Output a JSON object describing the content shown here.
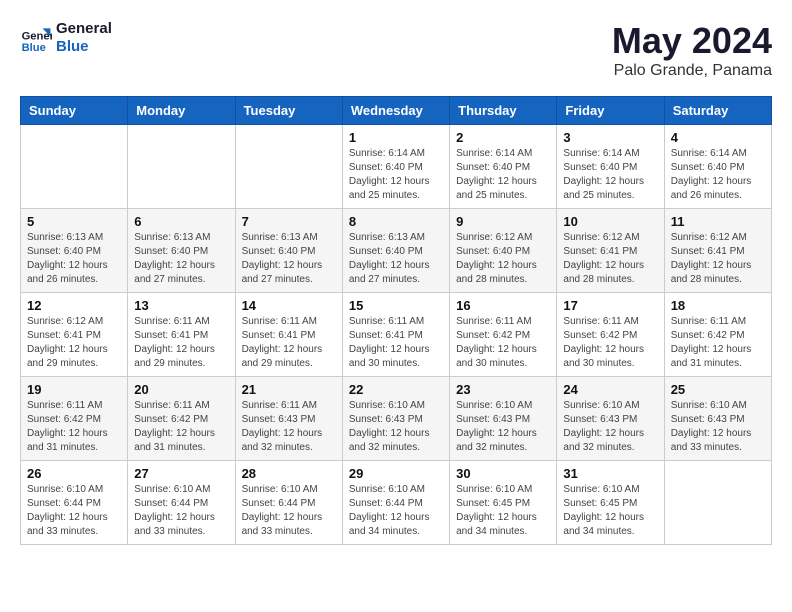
{
  "header": {
    "logo_line1": "General",
    "logo_line2": "Blue",
    "title": "May 2024",
    "subtitle": "Palo Grande, Panama"
  },
  "weekdays": [
    "Sunday",
    "Monday",
    "Tuesday",
    "Wednesday",
    "Thursday",
    "Friday",
    "Saturday"
  ],
  "weeks": [
    [
      {
        "day": "",
        "info": ""
      },
      {
        "day": "",
        "info": ""
      },
      {
        "day": "",
        "info": ""
      },
      {
        "day": "1",
        "info": "Sunrise: 6:14 AM\nSunset: 6:40 PM\nDaylight: 12 hours\nand 25 minutes."
      },
      {
        "day": "2",
        "info": "Sunrise: 6:14 AM\nSunset: 6:40 PM\nDaylight: 12 hours\nand 25 minutes."
      },
      {
        "day": "3",
        "info": "Sunrise: 6:14 AM\nSunset: 6:40 PM\nDaylight: 12 hours\nand 25 minutes."
      },
      {
        "day": "4",
        "info": "Sunrise: 6:14 AM\nSunset: 6:40 PM\nDaylight: 12 hours\nand 26 minutes."
      }
    ],
    [
      {
        "day": "5",
        "info": "Sunrise: 6:13 AM\nSunset: 6:40 PM\nDaylight: 12 hours\nand 26 minutes."
      },
      {
        "day": "6",
        "info": "Sunrise: 6:13 AM\nSunset: 6:40 PM\nDaylight: 12 hours\nand 27 minutes."
      },
      {
        "day": "7",
        "info": "Sunrise: 6:13 AM\nSunset: 6:40 PM\nDaylight: 12 hours\nand 27 minutes."
      },
      {
        "day": "8",
        "info": "Sunrise: 6:13 AM\nSunset: 6:40 PM\nDaylight: 12 hours\nand 27 minutes."
      },
      {
        "day": "9",
        "info": "Sunrise: 6:12 AM\nSunset: 6:40 PM\nDaylight: 12 hours\nand 28 minutes."
      },
      {
        "day": "10",
        "info": "Sunrise: 6:12 AM\nSunset: 6:41 PM\nDaylight: 12 hours\nand 28 minutes."
      },
      {
        "day": "11",
        "info": "Sunrise: 6:12 AM\nSunset: 6:41 PM\nDaylight: 12 hours\nand 28 minutes."
      }
    ],
    [
      {
        "day": "12",
        "info": "Sunrise: 6:12 AM\nSunset: 6:41 PM\nDaylight: 12 hours\nand 29 minutes."
      },
      {
        "day": "13",
        "info": "Sunrise: 6:11 AM\nSunset: 6:41 PM\nDaylight: 12 hours\nand 29 minutes."
      },
      {
        "day": "14",
        "info": "Sunrise: 6:11 AM\nSunset: 6:41 PM\nDaylight: 12 hours\nand 29 minutes."
      },
      {
        "day": "15",
        "info": "Sunrise: 6:11 AM\nSunset: 6:41 PM\nDaylight: 12 hours\nand 30 minutes."
      },
      {
        "day": "16",
        "info": "Sunrise: 6:11 AM\nSunset: 6:42 PM\nDaylight: 12 hours\nand 30 minutes."
      },
      {
        "day": "17",
        "info": "Sunrise: 6:11 AM\nSunset: 6:42 PM\nDaylight: 12 hours\nand 30 minutes."
      },
      {
        "day": "18",
        "info": "Sunrise: 6:11 AM\nSunset: 6:42 PM\nDaylight: 12 hours\nand 31 minutes."
      }
    ],
    [
      {
        "day": "19",
        "info": "Sunrise: 6:11 AM\nSunset: 6:42 PM\nDaylight: 12 hours\nand 31 minutes."
      },
      {
        "day": "20",
        "info": "Sunrise: 6:11 AM\nSunset: 6:42 PM\nDaylight: 12 hours\nand 31 minutes."
      },
      {
        "day": "21",
        "info": "Sunrise: 6:11 AM\nSunset: 6:43 PM\nDaylight: 12 hours\nand 32 minutes."
      },
      {
        "day": "22",
        "info": "Sunrise: 6:10 AM\nSunset: 6:43 PM\nDaylight: 12 hours\nand 32 minutes."
      },
      {
        "day": "23",
        "info": "Sunrise: 6:10 AM\nSunset: 6:43 PM\nDaylight: 12 hours\nand 32 minutes."
      },
      {
        "day": "24",
        "info": "Sunrise: 6:10 AM\nSunset: 6:43 PM\nDaylight: 12 hours\nand 32 minutes."
      },
      {
        "day": "25",
        "info": "Sunrise: 6:10 AM\nSunset: 6:43 PM\nDaylight: 12 hours\nand 33 minutes."
      }
    ],
    [
      {
        "day": "26",
        "info": "Sunrise: 6:10 AM\nSunset: 6:44 PM\nDaylight: 12 hours\nand 33 minutes."
      },
      {
        "day": "27",
        "info": "Sunrise: 6:10 AM\nSunset: 6:44 PM\nDaylight: 12 hours\nand 33 minutes."
      },
      {
        "day": "28",
        "info": "Sunrise: 6:10 AM\nSunset: 6:44 PM\nDaylight: 12 hours\nand 33 minutes."
      },
      {
        "day": "29",
        "info": "Sunrise: 6:10 AM\nSunset: 6:44 PM\nDaylight: 12 hours\nand 34 minutes."
      },
      {
        "day": "30",
        "info": "Sunrise: 6:10 AM\nSunset: 6:45 PM\nDaylight: 12 hours\nand 34 minutes."
      },
      {
        "day": "31",
        "info": "Sunrise: 6:10 AM\nSunset: 6:45 PM\nDaylight: 12 hours\nand 34 minutes."
      },
      {
        "day": "",
        "info": ""
      }
    ]
  ]
}
